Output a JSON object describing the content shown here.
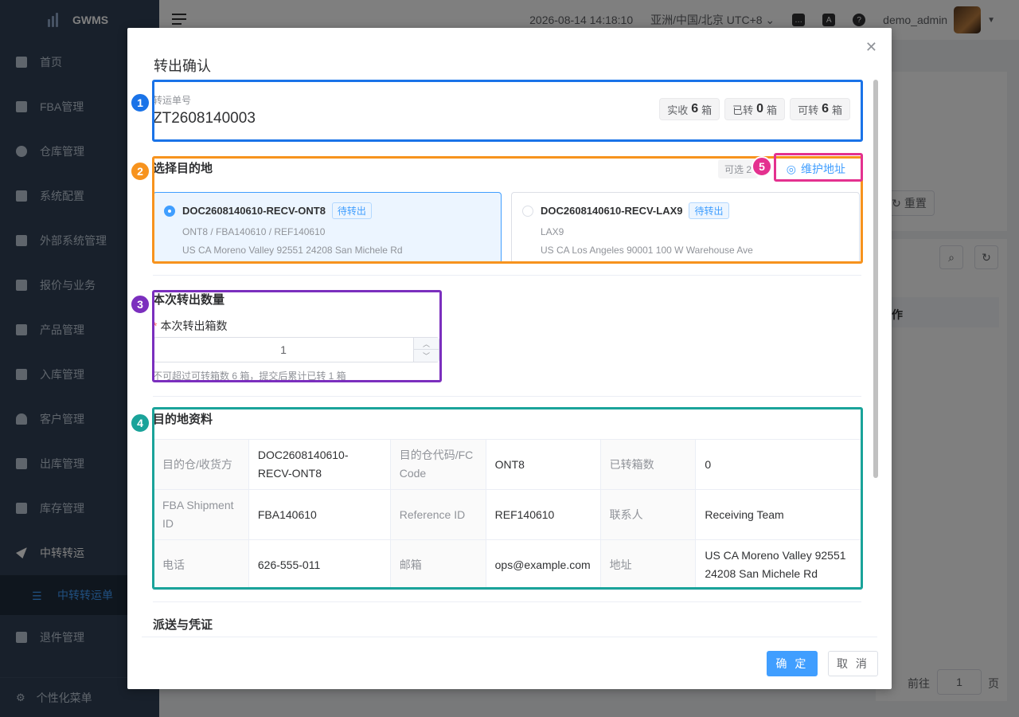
{
  "sidebar": {
    "logo": "GWMS",
    "items": [
      {
        "label": "首页"
      },
      {
        "label": "FBA管理"
      },
      {
        "label": "仓库管理"
      },
      {
        "label": "系统配置"
      },
      {
        "label": "外部系统管理"
      },
      {
        "label": "报价与业务"
      },
      {
        "label": "产品管理"
      },
      {
        "label": "入库管理"
      },
      {
        "label": "客户管理"
      },
      {
        "label": "出库管理"
      },
      {
        "label": "库存管理"
      },
      {
        "label": "中转转运"
      }
    ],
    "active_sub": "中转转运单",
    "after_items": [
      {
        "label": "退件管理"
      }
    ],
    "bottom": "个性化菜单"
  },
  "header": {
    "datetime": "2026-08-14 14:18:10",
    "timezone": "亚洲/中国/北京 UTC+8",
    "username": "demo_admin"
  },
  "background": {
    "reset_label": "重置",
    "column_header": "作",
    "pager_prefix": "前往",
    "pager_value": "1",
    "pager_suffix": "页"
  },
  "modal": {
    "title": "转出确认",
    "transfer": {
      "label": "转运单号",
      "number": "ZT2608140003",
      "stats": [
        {
          "prefix": "实收",
          "value": "6",
          "suffix": "箱"
        },
        {
          "prefix": "已转",
          "value": "0",
          "suffix": "箱"
        },
        {
          "prefix": "可转",
          "value": "6",
          "suffix": "箱"
        }
      ]
    },
    "destination": {
      "title": "选择目的地",
      "pick_count": "可选 2",
      "maintain_label": "维护地址",
      "cards": [
        {
          "name": "DOC2608140610-RECV-ONT8",
          "badge": "待转出",
          "line1": "ONT8 / FBA140610 / REF140610",
          "line2": "US CA Moreno Valley 92551 24208 San Michele Rd",
          "selected": true
        },
        {
          "name": "DOC2608140610-RECV-LAX9",
          "badge": "待转出",
          "line1": "LAX9",
          "line2": "US CA Los Angeles 90001 100 W Warehouse Ave",
          "selected": false
        }
      ]
    },
    "quantity": {
      "title": "本次转出数量",
      "field_label": "本次转出箱数",
      "required_mark": "*",
      "value": "1",
      "hint": "不可超过可转箱数 6 箱，提交后累计已转 1 箱"
    },
    "info": {
      "title": "目的地资料",
      "rows": [
        [
          {
            "k": "目的仓/收货方",
            "v": "DOC2608140610-RECV-ONT8"
          },
          {
            "k": "目的仓代码/FC Code",
            "v": "ONT8"
          },
          {
            "k": "已转箱数",
            "v": "0"
          }
        ],
        [
          {
            "k": "FBA Shipment ID",
            "v": "FBA140610"
          },
          {
            "k": "Reference ID",
            "v": "REF140610"
          },
          {
            "k": "联系人",
            "v": "Receiving Team"
          }
        ],
        [
          {
            "k": "电话",
            "v": "626-555-011"
          },
          {
            "k": "邮箱",
            "v": "ops@example.com"
          },
          {
            "k": "地址",
            "v": "US CA Moreno Valley 92551 24208 San Michele Rd"
          }
        ]
      ]
    },
    "delivery_title": "派送与凭证",
    "confirm_label": "确 定",
    "cancel_label": "取 消"
  },
  "annotations": [
    {
      "label": "1",
      "color": "#1a73e8"
    },
    {
      "label": "2",
      "color": "#f7931e"
    },
    {
      "label": "3",
      "color": "#7b2fbe"
    },
    {
      "label": "4",
      "color": "#1aa39a"
    },
    {
      "label": "5",
      "color": "#e4318f"
    }
  ],
  "colors": {
    "primary": "#409eff",
    "sidebar_bg": "#304156"
  }
}
